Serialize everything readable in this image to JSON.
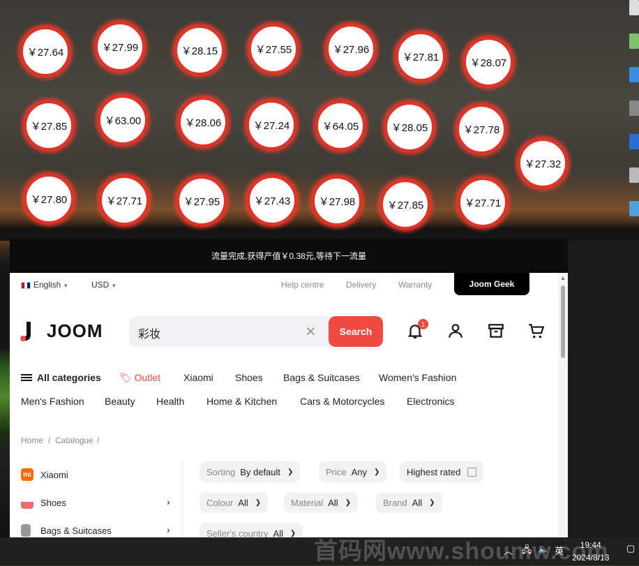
{
  "bubbles": [
    {
      "label": "￥27.64"
    },
    {
      "label": "￥27.99"
    },
    {
      "label": "￥28.15"
    },
    {
      "label": "￥27.55"
    },
    {
      "label": "￥27.96"
    },
    {
      "label": "￥27.81"
    },
    {
      "label": "￥28.07"
    },
    {
      "label": "￥27.85"
    },
    {
      "label": "￥63.00"
    },
    {
      "label": "￥28.06"
    },
    {
      "label": "￥27.24"
    },
    {
      "label": "￥64.05"
    },
    {
      "label": "￥28.05"
    },
    {
      "label": "￥27.78"
    },
    {
      "label": "￥27.32"
    },
    {
      "label": "￥27.80"
    },
    {
      "label": "￥27.71"
    },
    {
      "label": "￥27.95"
    },
    {
      "label": "￥27.43"
    },
    {
      "label": "￥27.98"
    },
    {
      "label": "￥27.85"
    },
    {
      "label": "￥27.71"
    }
  ],
  "flow_message": "流量完成,获得产值￥0.38元,等待下一流量",
  "topbar": {
    "language": "English",
    "currency": "USD",
    "help": "Help centre",
    "delivery": "Delivery",
    "warranty": "Warranty",
    "geek": "Joom Geek"
  },
  "header": {
    "logo_text": "JOOM",
    "search_value": "彩妆",
    "search_button": "Search",
    "notification_count": "1"
  },
  "nav": {
    "all_categories": "All categories",
    "row1": [
      "Outlet",
      "Xiaomi",
      "Shoes",
      "Bags & Suitcases",
      "Women's Fashion"
    ],
    "row2": [
      "Men's Fashion",
      "Beauty",
      "Health",
      "Home & Kitchen",
      "Cars & Motorcycles",
      "Electronics"
    ]
  },
  "breadcrumb": {
    "home": "Home",
    "catalogue": "Catalogue",
    "sep": "/"
  },
  "sidebar": [
    {
      "label": "Xiaomi"
    },
    {
      "label": "Shoes"
    },
    {
      "label": "Bags & Suitcases"
    }
  ],
  "filters": {
    "sorting": {
      "key": "Sorting",
      "value": "By default"
    },
    "price": {
      "key": "Price",
      "value": "Any"
    },
    "highest_rated": "Highest rated",
    "colour": {
      "key": "Colour",
      "value": "All"
    },
    "material": {
      "key": "Material",
      "value": "All"
    },
    "brand": {
      "key": "Brand",
      "value": "All"
    },
    "seller_country": {
      "key": "Seller's country",
      "value": "All"
    }
  },
  "taskbar": {
    "watermark": "首码网www.shoumw.com",
    "ime": "英",
    "time": "19:44",
    "date": "2024/8/13"
  },
  "colors": {
    "accent": "#f04a43",
    "bubble_ring": "#e03227"
  }
}
